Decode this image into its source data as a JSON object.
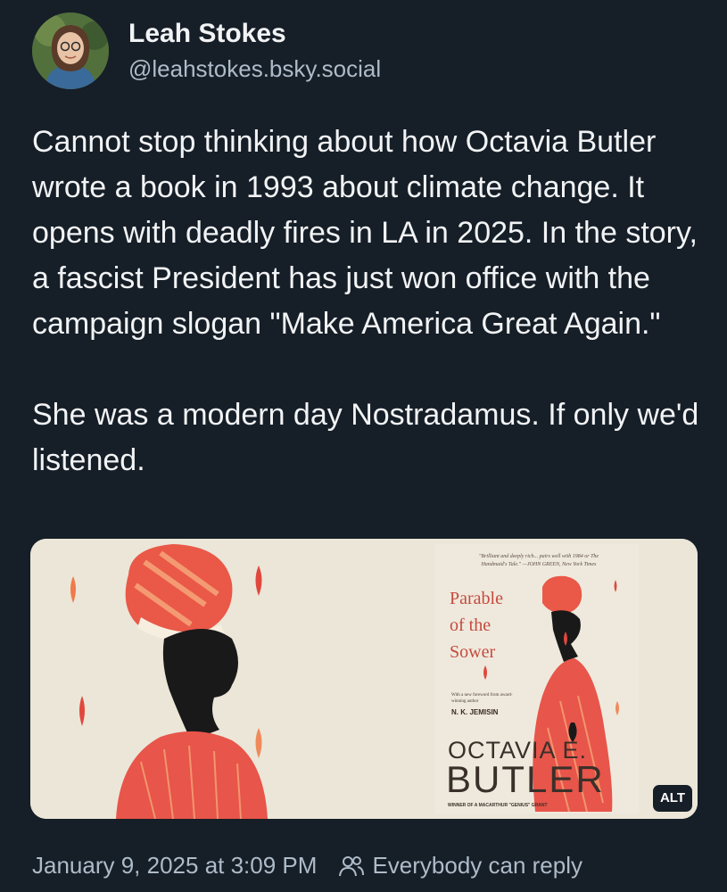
{
  "author": {
    "display_name": "Leah Stokes",
    "handle": "@leahstokes.bsky.social",
    "avatar_icon": "user-avatar"
  },
  "post": {
    "paragraphs": [
      "Cannot stop thinking about how Octavia Butler wrote a book in 1993 about climate change. It opens with deadly fires in LA in 2025. In the story, a fascist President has just won office with the campaign slogan \"Make America Great Again.\"",
      "She was a modern day Nostradamus. If only we'd listened."
    ]
  },
  "media": {
    "cover": {
      "blurb": "\"Brilliant and deeply rich... pairs well with 1984 or The Handmaid's Tale.\" —JOHN GREEN, New York Times",
      "title_line1": "Parable",
      "title_line2": "of the",
      "title_line3": "Sower",
      "foreword": "With a new foreword from award-winning author",
      "foreword_author": "N. K. JEMISIN",
      "author_first": "OCTAVIA E.",
      "author_last": "BUTLER",
      "award": "WINNER OF A MACARTHUR \"GENIUS\" GRANT"
    },
    "alt_label": "ALT"
  },
  "footer": {
    "timestamp": "January 9, 2025 at 3:09 PM",
    "reply_icon": "people-icon",
    "reply_setting": "Everybody can reply"
  },
  "colors": {
    "background": "#161e27",
    "text_primary": "#f1f3f5",
    "text_secondary": "#aebbc9",
    "cover_red": "#e8554a",
    "cover_orange": "#f08a5a"
  }
}
